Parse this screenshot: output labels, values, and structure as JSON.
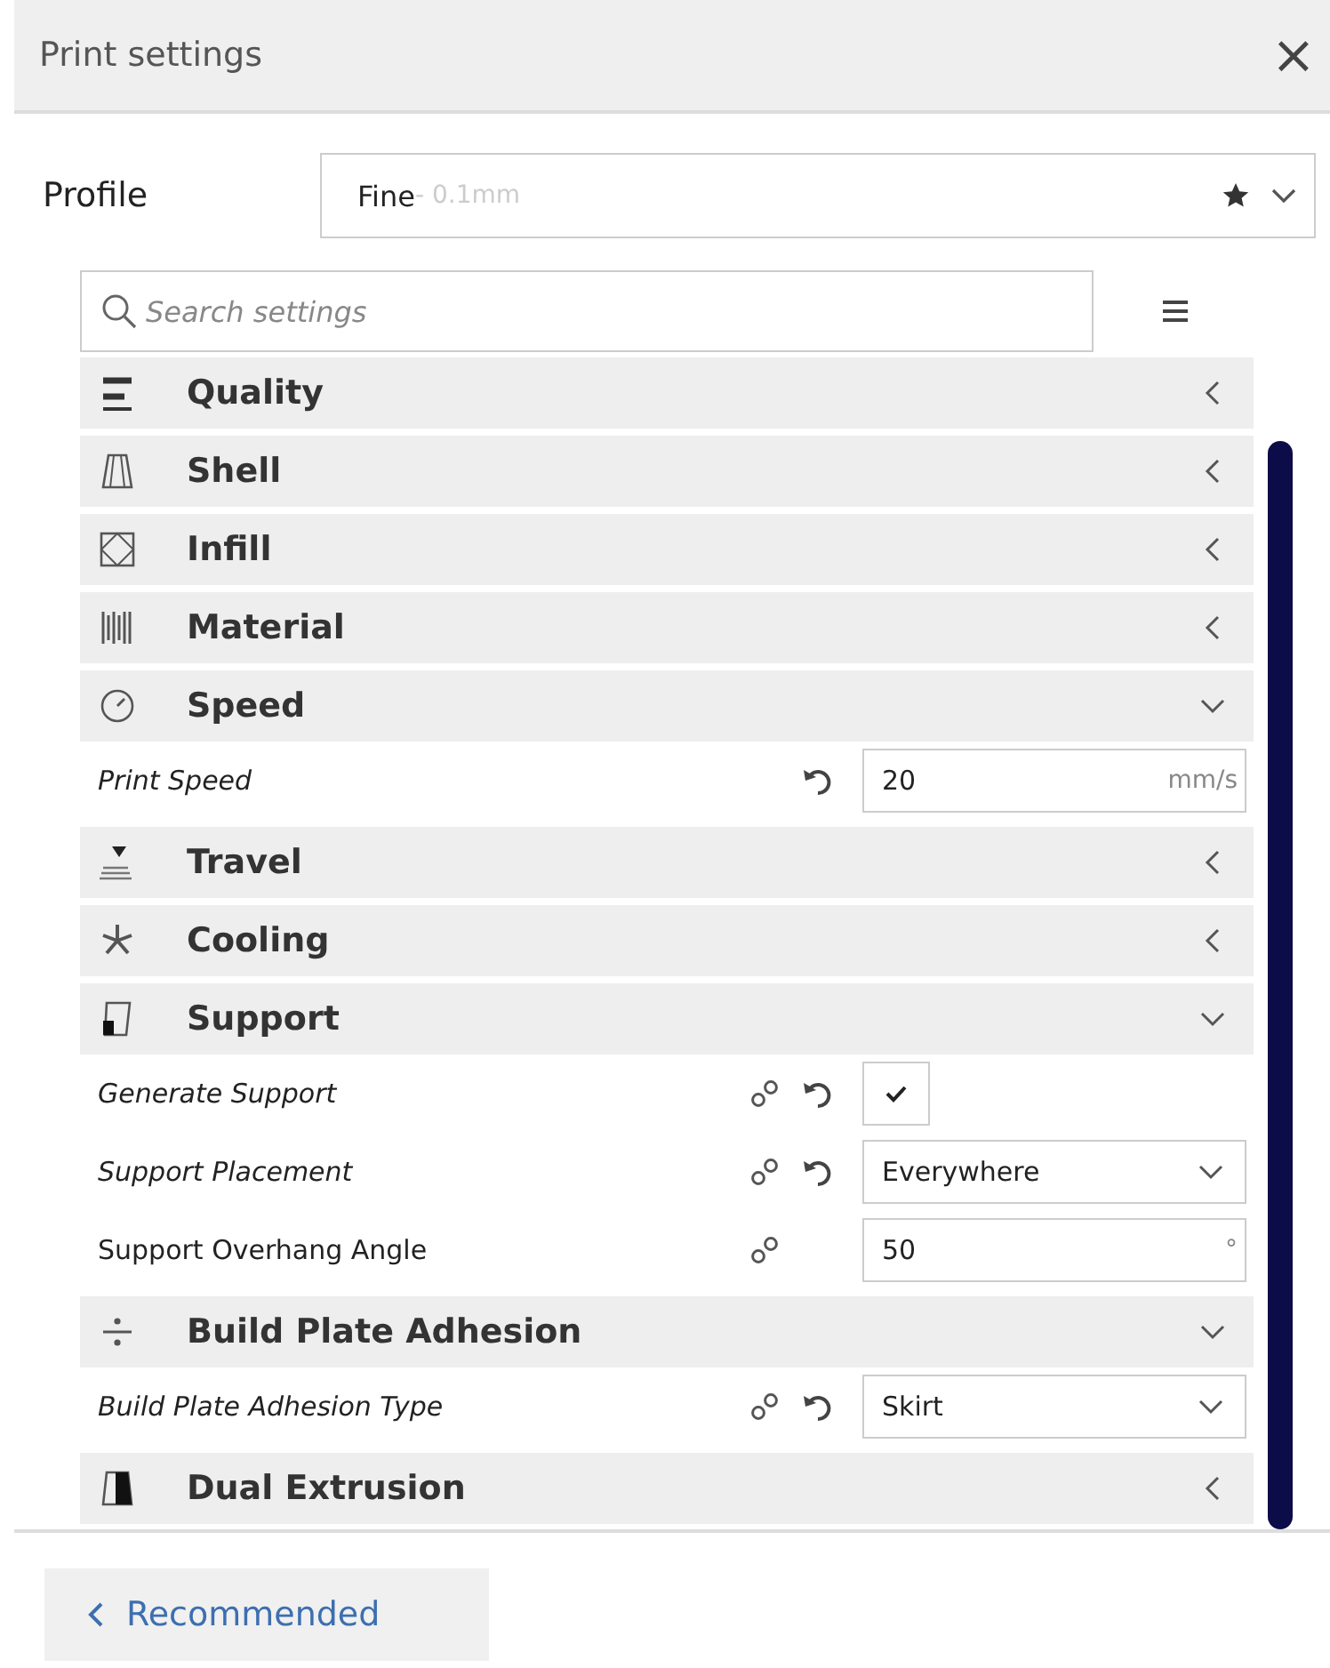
{
  "panel": {
    "title": "Print settings",
    "close": "×"
  },
  "profile": {
    "label": "Profile",
    "name": "Fine",
    "detail": " - 0.1mm",
    "favorite": true
  },
  "search": {
    "placeholder": "Search settings"
  },
  "categories": [
    {
      "name": "Quality",
      "expanded": false
    },
    {
      "name": "Shell",
      "expanded": false
    },
    {
      "name": "Infill",
      "expanded": false
    },
    {
      "name": "Material",
      "expanded": false
    },
    {
      "name": "Speed",
      "expanded": true,
      "settings": [
        {
          "label": "Print Speed",
          "kind": "number",
          "modified": true,
          "linked": false,
          "resettable": true,
          "value": "20",
          "unit": "mm/s"
        }
      ]
    },
    {
      "name": "Travel",
      "expanded": false
    },
    {
      "name": "Cooling",
      "expanded": false
    },
    {
      "name": "Support",
      "expanded": true,
      "settings": [
        {
          "label": "Generate Support",
          "kind": "checkbox",
          "modified": true,
          "linked": true,
          "resettable": true,
          "checked": true
        },
        {
          "label": "Support Placement",
          "kind": "dropdown",
          "modified": true,
          "linked": true,
          "resettable": true,
          "value": "Everywhere"
        },
        {
          "label": "Support Overhang Angle",
          "kind": "number",
          "modified": false,
          "linked": true,
          "resettable": false,
          "value": "50",
          "unit": "°"
        }
      ]
    },
    {
      "name": "Build Plate Adhesion",
      "expanded": true,
      "settings": [
        {
          "label": "Build Plate Adhesion Type",
          "kind": "dropdown",
          "modified": true,
          "linked": true,
          "resettable": true,
          "value": "Skirt"
        }
      ]
    },
    {
      "name": "Dual Extrusion",
      "expanded": false
    }
  ],
  "footer": {
    "button": "Recommended"
  }
}
